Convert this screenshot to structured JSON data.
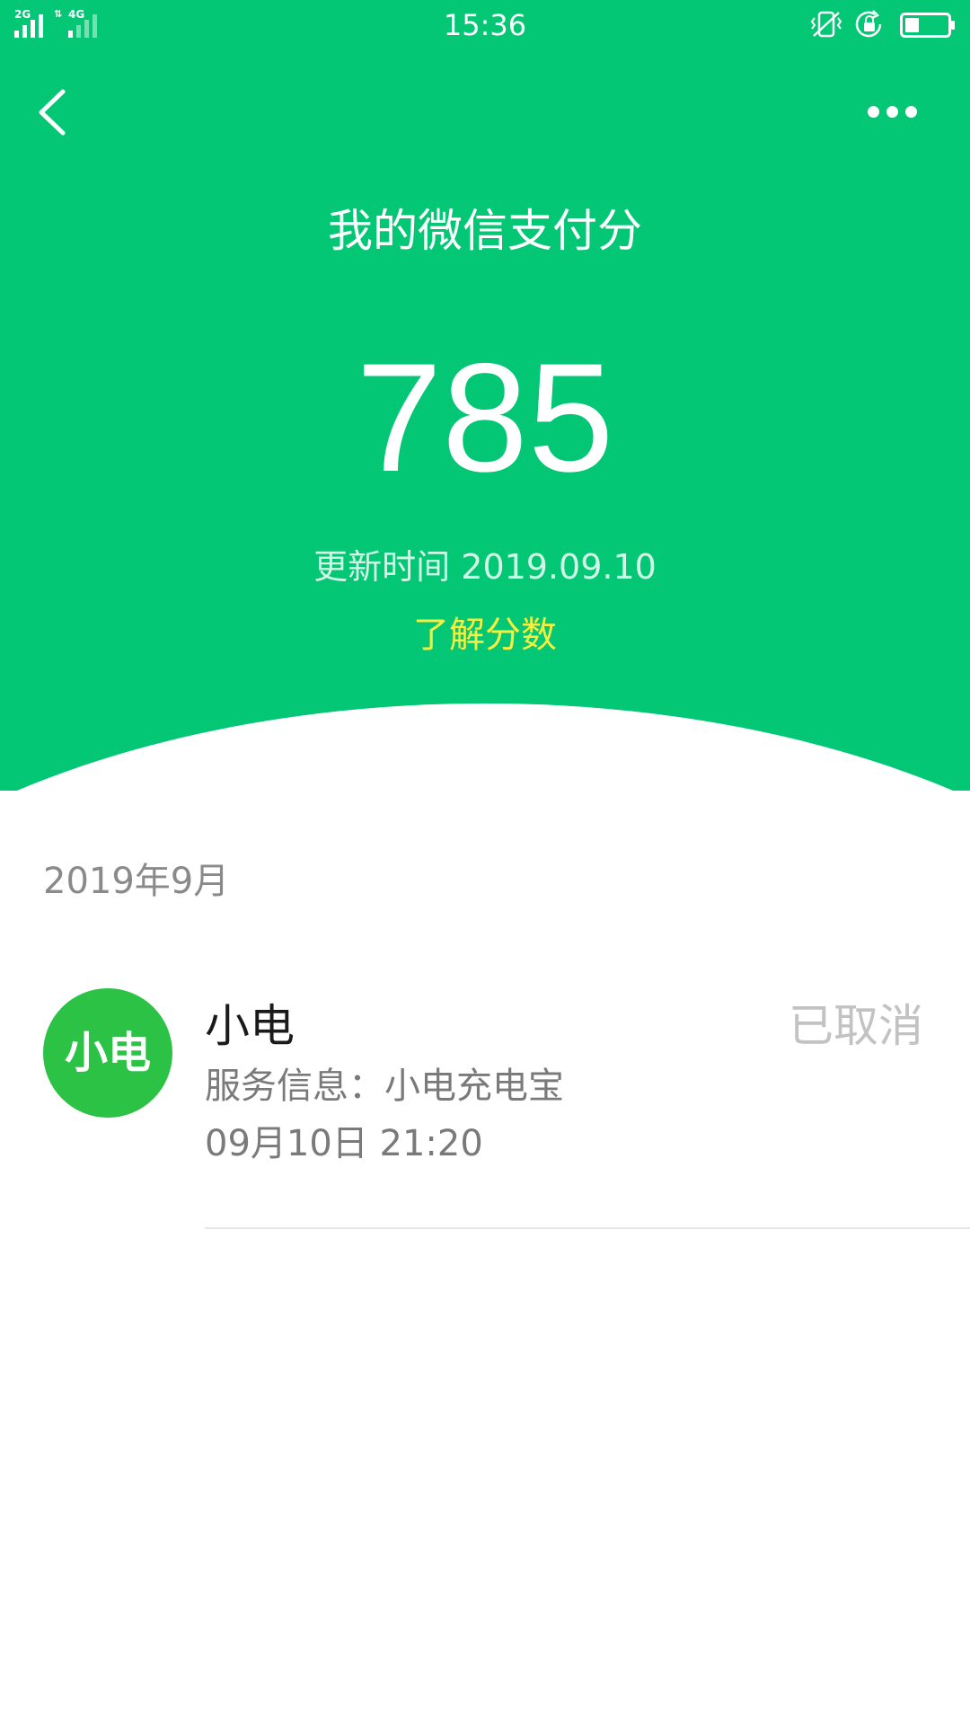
{
  "status_bar": {
    "time": "15:36",
    "sim1_network": "2G",
    "sim2_network": "4G",
    "battery_level": 0.3,
    "icons": [
      "vibrate-icon",
      "rotation-lock-icon",
      "battery-icon"
    ]
  },
  "header": {
    "title": "我的微信支付分",
    "score": "785",
    "update_label": "更新时间",
    "update_date": "2019.09.10",
    "learn_more": "了解分数",
    "accent_color": "#03c775",
    "link_color": "#f5f040"
  },
  "records": {
    "month": "2019年9月",
    "items": [
      {
        "avatar_text": "小电",
        "merchant": "小电",
        "service_info": "服务信息：小电充电宝",
        "time": "09月10日 21:20",
        "status": "已取消"
      }
    ]
  }
}
